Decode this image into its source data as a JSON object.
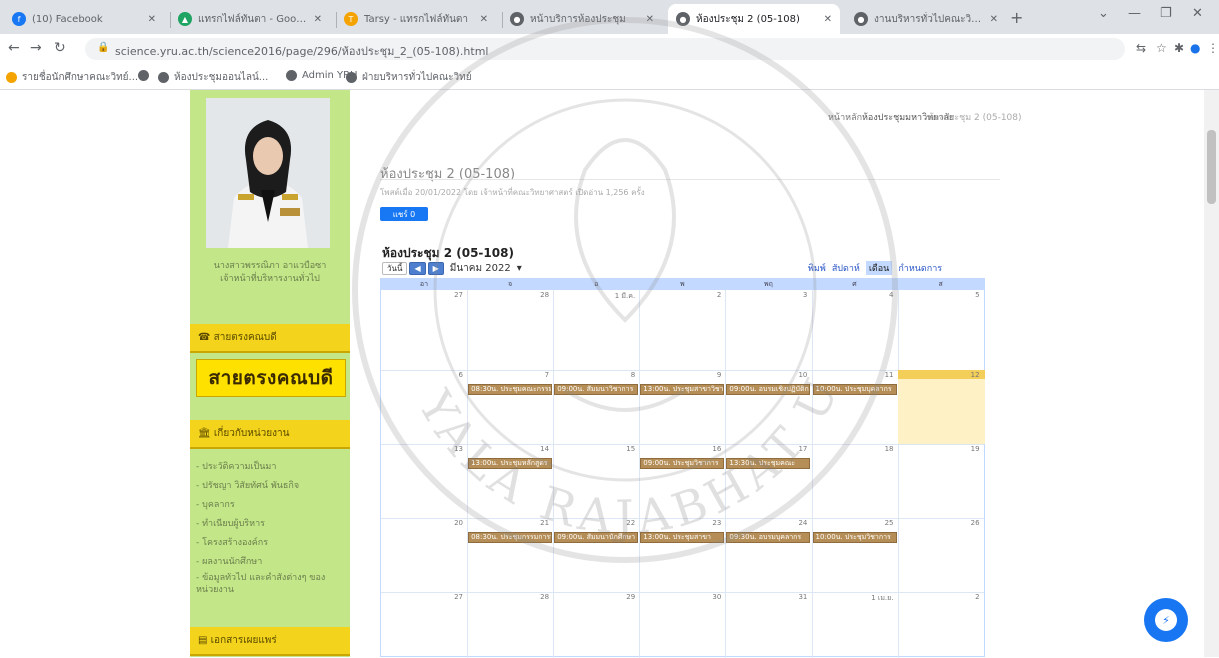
{
  "browser": {
    "tabs": [
      {
        "title": "(10) Facebook",
        "icon": "facebook-icon",
        "color": "#1877f2"
      },
      {
        "title": "แทรกไฟล์ทันตา - Google ไดรฟ์",
        "icon": "drive-icon",
        "color": "#1fa463"
      },
      {
        "title": "Tarsy - แทรกไฟล์ทันตา",
        "icon": "tarsy-icon",
        "color": "#f4a300"
      },
      {
        "title": "หน้าบริการห้องประชุม",
        "icon": "globe-icon",
        "color": "#5f6368"
      },
      {
        "title": "ห้องประชุม 2 (05-108)",
        "icon": "globe-icon",
        "color": "#5f6368"
      },
      {
        "title": "งานบริหารทั่วไปคณะวิทยาศาสตร์",
        "icon": "globe-icon",
        "color": "#5f6368"
      }
    ],
    "new_tab": "+",
    "url": "science.yru.ac.th/science2016/page/296/ห้องประชุม_2_(05-108).html",
    "bookmarks": [
      "รายชื่อนักศึกษาคณะวิทย์...",
      "",
      "ห้องประชุมออนไลน์...",
      "Admin YRU",
      "ฝ่ายบริหารทั่วไปคณะวิทย์"
    ]
  },
  "sidebar": {
    "staff_name": "นางสาวพรรณิภา อาแวบือซา",
    "staff_role": "เจ้าหน้าที่บริหารงานทั่วไป",
    "hotline_title": "สายตรงคณบดี",
    "hotline_banner": "สายตรงคณบดี",
    "about_title": "เกี่ยวกับหน่วยงาน",
    "links": [
      "ประวัติความเป็นมา",
      "ปรัชญา วิสัยทัศน์ พันธกิจ",
      "บุคลากร",
      "ทำเนียบผู้บริหาร",
      "โครงสร้างองค์กร",
      "ผลงานนักศึกษา",
      "ข้อมูลทั่วไป และคำสั่งต่างๆ ของหน่วยงาน"
    ],
    "docs_title": "เอกสารเผยแพร่"
  },
  "content": {
    "breadcrumb": [
      "หน้าหลัก",
      "ห้องประชุมมหาวิทยาลัย",
      "ห้องประชุม 2 (05-108)"
    ],
    "title": "ห้องประชุม 2 (05-108)",
    "meta": "โพสต์เมื่อ 20/01/2022 โดย เจ้าหน้าที่คณะวิทยาศาสตร์ เปิดอ่าน 1,256 ครั้ง",
    "share_label": "แชร์ 0",
    "calendar": {
      "name": "ห้องประชุม 2 (05-108)",
      "today_btn": "วันนี้",
      "month_label": "มีนาคม 2022",
      "modes": [
        "พิมพ์",
        "สัปดาห์",
        "เดือน",
        "กำหนดการ"
      ],
      "active_mode": "เดือน",
      "weekdays": [
        "อา",
        "จ",
        "อ",
        "พ",
        "พฤ",
        "ศ",
        "ส"
      ],
      "weeks": [
        [
          "27",
          "28",
          "1 มี.ค.",
          "2",
          "3",
          "4",
          "5"
        ],
        [
          "6",
          "7",
          "8",
          "9",
          "10",
          "11",
          "12"
        ],
        [
          "13",
          "14",
          "15",
          "16",
          "17",
          "18",
          "19"
        ],
        [
          "20",
          "21",
          "22",
          "23",
          "24",
          "25",
          "26"
        ],
        [
          "27",
          "28",
          "29",
          "30",
          "31",
          "1 เม.ย.",
          "2"
        ]
      ],
      "today_index": [
        1,
        6
      ],
      "events": [
        {
          "week": 1,
          "day": 1,
          "text": "08:30น. ประชุมคณะกรรมการ"
        },
        {
          "week": 1,
          "day": 2,
          "text": "09:00น. สัมมนาวิชาการ"
        },
        {
          "week": 1,
          "day": 3,
          "text": "13:00น. ประชุมสาขาวิชา"
        },
        {
          "week": 1,
          "day": 4,
          "text": "09:00น. อบรมเชิงปฏิบัติการ"
        },
        {
          "week": 1,
          "day": 5,
          "text": "10:00น. ประชุมบุคลากร"
        },
        {
          "week": 2,
          "day": 1,
          "text": "13:00น. ประชุมหลักสูตร"
        },
        {
          "week": 2,
          "day": 3,
          "text": "09:00น. ประชุมวิชาการ"
        },
        {
          "week": 2,
          "day": 4,
          "text": "13:30น. ประชุมคณะ"
        },
        {
          "week": 3,
          "day": 1,
          "text": "08:30น. ประชุมกรรมการประจำคณะ"
        },
        {
          "week": 3,
          "day": 2,
          "text": "09:00น. สัมมนานักศึกษา"
        },
        {
          "week": 3,
          "day": 3,
          "text": "13:00น. ประชุมสาขา"
        },
        {
          "week": 3,
          "day": 4,
          "text": "09:30น. อบรมบุคลากร"
        },
        {
          "week": 3,
          "day": 5,
          "text": "10:00น. ประชุมวิชาการ"
        }
      ]
    }
  },
  "watermark_text": "YALA RAJABHAT UNIVERSITY"
}
